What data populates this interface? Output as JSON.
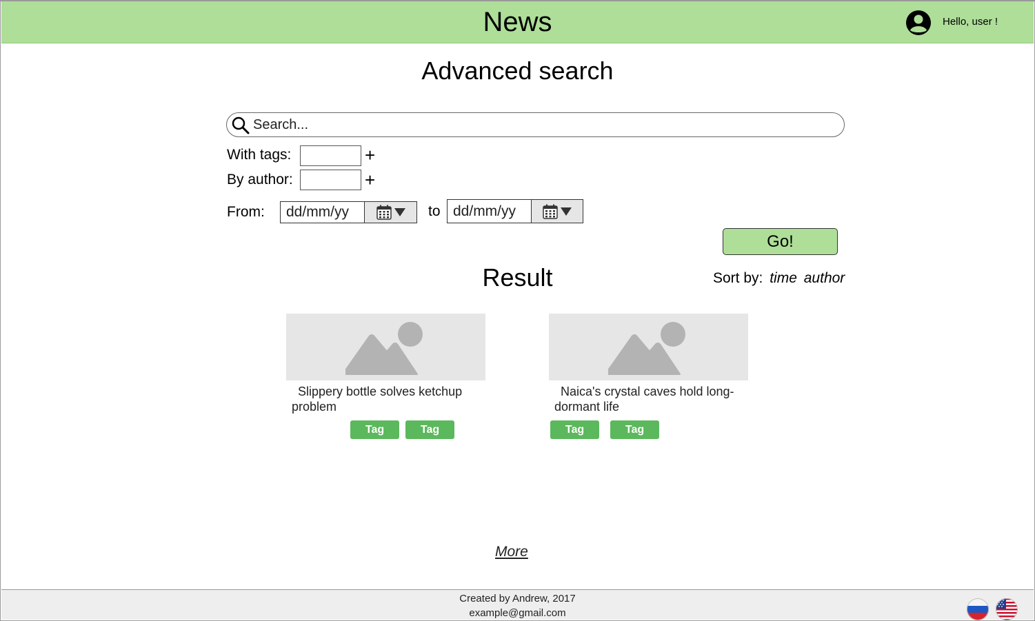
{
  "header": {
    "title": "News",
    "greeting": "Hello, user !"
  },
  "page": {
    "title": "Advanced search"
  },
  "search": {
    "placeholder": "Search..."
  },
  "filters": {
    "tags_label": "With tags:",
    "author_label": "By author:",
    "add_symbol": "+",
    "from_label": "From:",
    "to_label": "to",
    "date_placeholder": "dd/mm/yy"
  },
  "go_label": "Go!",
  "results": {
    "title": "Result",
    "sort_label": "Sort by:",
    "sort_options": [
      "time",
      "author"
    ],
    "items": [
      {
        "headline": "Slippery bottle solves ketchup problem",
        "tags": [
          "Tag",
          "Tag"
        ]
      },
      {
        "headline": "Naica's crystal caves hold long-dormant life",
        "tags": [
          "Tag",
          "Tag"
        ]
      }
    ],
    "more_label": "More"
  },
  "footer": {
    "credit": "Created by Andrew, 2017",
    "email": "example@gmail.com"
  },
  "languages": [
    "russian-flag-icon",
    "us-flag-icon"
  ],
  "colors": {
    "header_bg": "#aede98",
    "tag_bg": "#5cb85c",
    "footer_bg": "#eeeeee",
    "placeholder_bg": "#e6e6e6"
  }
}
